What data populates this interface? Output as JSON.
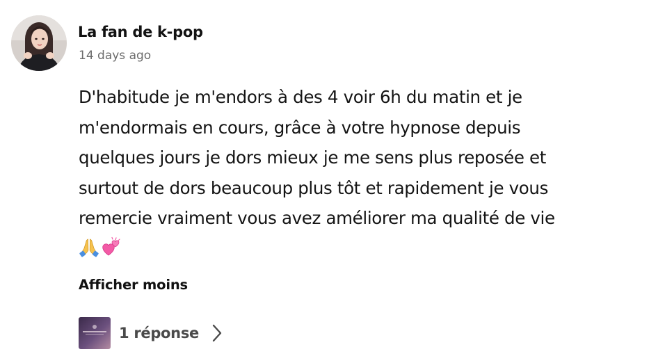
{
  "comment": {
    "author": "La fan de k-pop",
    "timestamp": "14 days ago",
    "avatar_icon": "user-avatar-photo",
    "body_lines": [
      "D'habitude je m'endors à des 4 voir 6h du matin et je",
      "m'endormais en cours, grâce à votre hypnose depuis",
      "quelques jours je dors mieux je me sens plus reposée et",
      "surtout de dors beaucoup plus tôt et rapidement je vous",
      "remercie vraiment vous avez améliorer ma qualité de vie"
    ],
    "emojis": [
      "folded-hands-emoji",
      "revolving-hearts-emoji"
    ],
    "toggle_label": "Afficher moins",
    "replies": {
      "label": "1 réponse",
      "thumbnail_icon": "channel-thumbnail",
      "chevron_icon": "chevron-right-icon"
    }
  }
}
